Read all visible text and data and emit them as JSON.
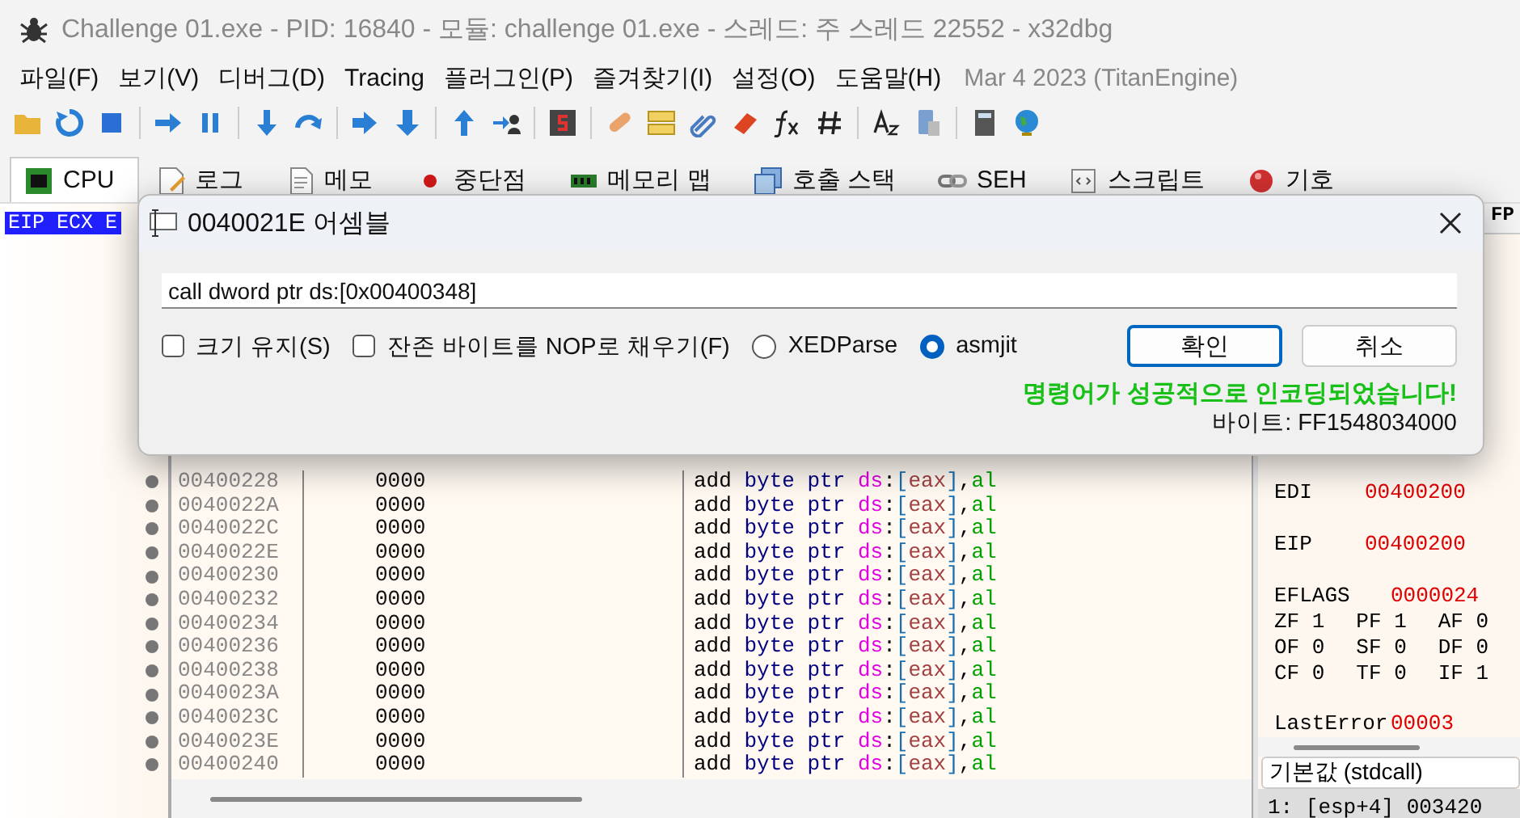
{
  "window": {
    "title": "Challenge 01.exe - PID: 16840 - 모듈: challenge 01.exe - 스레드: 주 스레드 22552 - x32dbg"
  },
  "menu": [
    {
      "label": "파일(F)"
    },
    {
      "label": "보기(V)"
    },
    {
      "label": "디버그(D)"
    },
    {
      "label": "Tracing"
    },
    {
      "label": "플러그인(P)"
    },
    {
      "label": "즐겨찾기(I)"
    },
    {
      "label": "설정(O)"
    },
    {
      "label": "도움말(H)"
    }
  ],
  "build_info": "Mar 4 2023 (TitanEngine)",
  "tabs": [
    {
      "label": "CPU",
      "selected": true
    },
    {
      "label": "로그",
      "selected": false
    },
    {
      "label": "메모",
      "selected": false
    },
    {
      "label": "중단점",
      "selected": false
    },
    {
      "label": "메모리 맵",
      "selected": false
    },
    {
      "label": "호출 스택",
      "selected": false
    },
    {
      "label": "SEH",
      "selected": false
    },
    {
      "label": "스크립트",
      "selected": false
    },
    {
      "label": "기호",
      "selected": false
    }
  ],
  "disassembly": {
    "header": "EIP ECX E",
    "rows": [
      {
        "address": "00400228",
        "bytes": "0000",
        "mnemonic": "add",
        "operands": "byte ptr ds:[eax],al"
      },
      {
        "address": "0040022A",
        "bytes": "0000",
        "mnemonic": "add",
        "operands": "byte ptr ds:[eax],al"
      },
      {
        "address": "0040022C",
        "bytes": "0000",
        "mnemonic": "add",
        "operands": "byte ptr ds:[eax],al"
      },
      {
        "address": "0040022E",
        "bytes": "0000",
        "mnemonic": "add",
        "operands": "byte ptr ds:[eax],al"
      },
      {
        "address": "00400230",
        "bytes": "0000",
        "mnemonic": "add",
        "operands": "byte ptr ds:[eax],al"
      },
      {
        "address": "00400232",
        "bytes": "0000",
        "mnemonic": "add",
        "operands": "byte ptr ds:[eax],al"
      },
      {
        "address": "00400234",
        "bytes": "0000",
        "mnemonic": "add",
        "operands": "byte ptr ds:[eax],al"
      },
      {
        "address": "00400236",
        "bytes": "0000",
        "mnemonic": "add",
        "operands": "byte ptr ds:[eax],al"
      },
      {
        "address": "00400238",
        "bytes": "0000",
        "mnemonic": "add",
        "operands": "byte ptr ds:[eax],al"
      },
      {
        "address": "0040023A",
        "bytes": "0000",
        "mnemonic": "add",
        "operands": "byte ptr ds:[eax],al"
      },
      {
        "address": "0040023C",
        "bytes": "0000",
        "mnemonic": "add",
        "operands": "byte ptr ds:[eax],al"
      },
      {
        "address": "0040023E",
        "bytes": "0000",
        "mnemonic": "add",
        "operands": "byte ptr ds:[eax],al"
      },
      {
        "address": "00400240",
        "bytes": "0000",
        "mnemonic": "add",
        "operands": "byte ptr ds:[eax],al"
      }
    ]
  },
  "registers": {
    "tab": "FP",
    "items": [
      {
        "name": "EDI",
        "value": "00400200"
      },
      {
        "name": "EIP",
        "value": "00400200"
      },
      {
        "name": "EFLAGS",
        "value": "0000024"
      }
    ],
    "flags": [
      [
        {
          "name": "ZF",
          "value": "1"
        },
        {
          "name": "PF",
          "value": "1"
        },
        {
          "name": "AF",
          "value": "0"
        }
      ],
      [
        {
          "name": "OF",
          "value": "0"
        },
        {
          "name": "SF",
          "value": "0"
        },
        {
          "name": "DF",
          "value": "0"
        }
      ],
      [
        {
          "name": "CF",
          "value": "0"
        },
        {
          "name": "TF",
          "value": "0"
        },
        {
          "name": "IF",
          "value": "1"
        }
      ]
    ],
    "last_error": {
      "name": "LastError",
      "value": "00003"
    }
  },
  "stack": {
    "convention": "기본값 (stdcall)",
    "rows": [
      {
        "text": "1: [esp+4] 003420",
        "selected": true
      }
    ]
  },
  "dialog": {
    "title": "0040021E 어셈블",
    "instruction": "call dword ptr ds:[0x00400348]",
    "checkboxes": [
      {
        "label": "크기 유지(S)",
        "checked": false
      },
      {
        "label": "잔존 바이트를 NOP로 채우기(F)",
        "checked": false
      }
    ],
    "radios": [
      {
        "label": "XEDParse",
        "selected": false
      },
      {
        "label": "asmjit",
        "selected": true
      }
    ],
    "buttons": [
      {
        "label": "확인",
        "focused": true
      },
      {
        "label": "취소",
        "focused": false
      }
    ],
    "status": "명령어가 성공적으로 인코딩되었습니다!",
    "bytes": "바이트: FF1548034000"
  }
}
